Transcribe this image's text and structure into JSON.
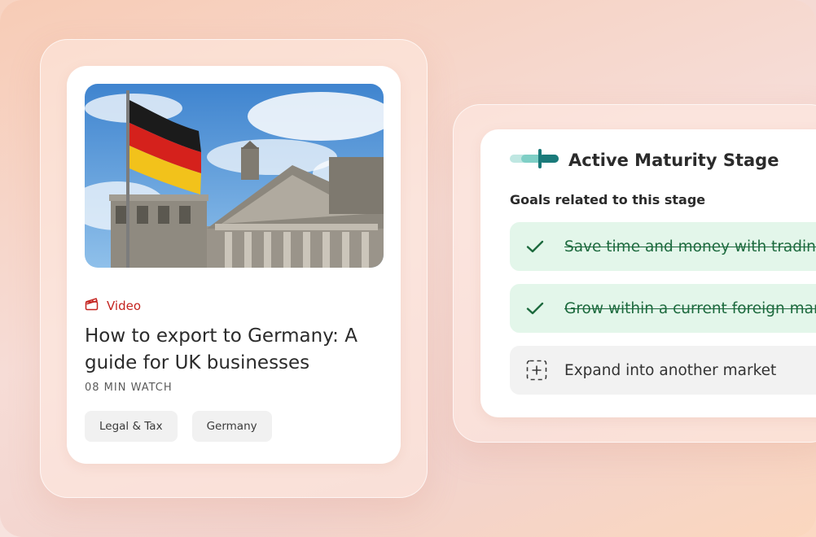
{
  "colors": {
    "accent_red": "#c4231f",
    "done_bg": "#e3f6ea",
    "done_text": "#1d6a3e",
    "todo_bg": "#f2f2f2",
    "teal": "#1a7a7a"
  },
  "content_card": {
    "image": "reichstag-with-german-flag-photo",
    "type_icon": "clapperboard-icon",
    "type_label": "Video",
    "title": "How to export to Germany: A guide for UK businesses",
    "duration": "08 MIN WATCH",
    "tags": [
      "Legal & Tax",
      "Germany"
    ]
  },
  "maturity_card": {
    "header_icon": "stage-progress-icon",
    "title": "Active Maturity Stage",
    "goals_label": "Goals related to this stage",
    "goals": [
      {
        "text": "Save time and money with trading a",
        "status": "done",
        "icon": "check-icon"
      },
      {
        "text": "Grow within a current foreign mark",
        "status": "done",
        "icon": "check-icon"
      },
      {
        "text": "Expand into another market",
        "status": "todo",
        "icon": "add-dashed-icon"
      }
    ]
  }
}
